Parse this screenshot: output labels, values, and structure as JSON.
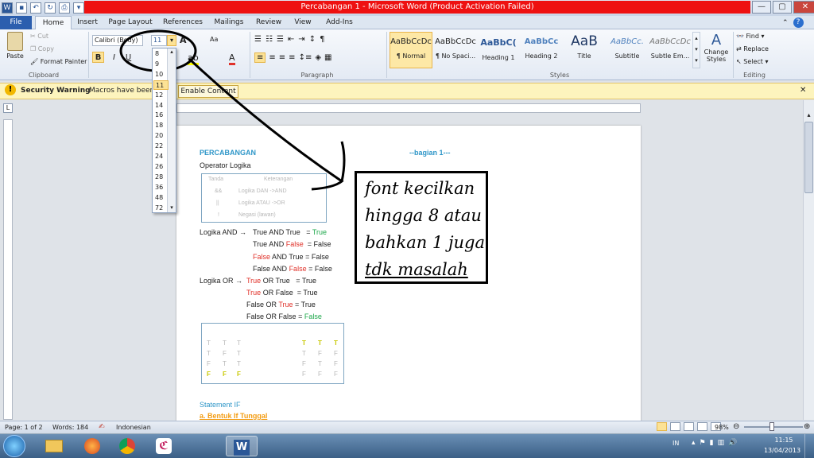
{
  "app": {
    "title": "Percabangan 1  -  Microsoft Word (Product Activation Failed)"
  },
  "window_controls": {
    "minimize": "—",
    "maximize": "▢",
    "close": "✕"
  },
  "tabs": [
    "File",
    "Home",
    "Insert",
    "Page Layout",
    "References",
    "Mailings",
    "Review",
    "View",
    "Add-Ins"
  ],
  "ribbon": {
    "clipboard": {
      "paste": "Paste",
      "cut": "Cut",
      "copy": "Copy",
      "format_painter": "Format Painter",
      "label": "Clipboard"
    },
    "font": {
      "name": "Calibri (Body)",
      "size": "11",
      "grow": "A",
      "shrink": "A",
      "change_case": "Aa",
      "clear": "Aa",
      "bold": "B",
      "italic": "I",
      "underline": "U",
      "label": "Font"
    },
    "paragraph": {
      "label": "Paragraph",
      "pilcrow": "¶"
    },
    "styles": {
      "label": "Styles",
      "items": [
        {
          "preview": "AaBbCcDc",
          "label": "¶ Normal"
        },
        {
          "preview": "AaBbCcDc",
          "label": "¶ No Spaci..."
        },
        {
          "preview": "AaBbC(",
          "label": "Heading 1"
        },
        {
          "preview": "AaBbCc",
          "label": "Heading 2"
        },
        {
          "preview": "AaB",
          "label": "Title"
        },
        {
          "preview": "AaBbCc.",
          "label": "Subtitle"
        },
        {
          "preview": "AaBbCcDc",
          "label": "Subtle Em..."
        }
      ],
      "change_styles": "Change Styles"
    },
    "editing": {
      "find": "Find",
      "replace": "Replace",
      "select": "Select",
      "label": "Editing"
    }
  },
  "security": {
    "title": "Security Warning",
    "message": "Macros have been disabled.",
    "button": "Enable Content",
    "close": "✕"
  },
  "font_sizes": [
    "8",
    "9",
    "10",
    "11",
    "12",
    "14",
    "16",
    "18",
    "20",
    "22",
    "24",
    "26",
    "28",
    "36",
    "48",
    "72"
  ],
  "document": {
    "heading": "PERCABANGAN",
    "part": "--bagian 1---",
    "operator_title": "Operator Logika",
    "op_table": {
      "headers": [
        "Tanda",
        "Keterangan"
      ],
      "rows": [
        [
          "&&",
          "Logika DAN ->AND"
        ],
        [
          "||",
          "Logika ATAU ->OR"
        ],
        [
          "!",
          "Negasi (lawan)"
        ]
      ]
    },
    "and_label": "Logika AND",
    "and_rows": [
      {
        "a": "True",
        "op": "AND",
        "b": "True",
        "res": "True"
      },
      {
        "a": "True",
        "op": "AND",
        "b": "False",
        "res": "False"
      },
      {
        "a": "False",
        "op": "AND",
        "b": "True",
        "res": "False"
      },
      {
        "a": "False",
        "op": "AND",
        "b": "False",
        "res": "False"
      }
    ],
    "or_label": "Logika OR",
    "or_rows": [
      {
        "a": "True",
        "op": "OR",
        "b": "True",
        "res": "True"
      },
      {
        "a": "True",
        "op": "OR",
        "b": "False",
        "res": "True"
      },
      {
        "a": "False",
        "op": "OR",
        "b": "True",
        "res": "True"
      },
      {
        "a": "False",
        "op": "OR",
        "b": "False",
        "res": "False"
      }
    ],
    "tf_left": [
      [
        "T",
        "T",
        "T"
      ],
      [
        "T",
        "F",
        "T"
      ],
      [
        "F",
        "T",
        "T"
      ],
      [
        "F",
        "F",
        "F"
      ]
    ],
    "tf_right": [
      [
        "T",
        "T",
        "T"
      ],
      [
        "T",
        "F",
        "F"
      ],
      [
        "F",
        "T",
        "F"
      ],
      [
        "F",
        "F",
        "F"
      ]
    ],
    "statement": "Statement IF",
    "bentuk": "a. Bentuk If Tunggal"
  },
  "annotation": {
    "lines": [
      "font kecilkan",
      "hingga 8 atau",
      "bahkan 1 juga",
      "tdk masalah"
    ]
  },
  "status": {
    "page": "Page: 1 of 2",
    "words": "Words: 184",
    "language": "Indonesian",
    "zoom": "98%"
  },
  "taskbar": {
    "lang": "IN",
    "time": "11:15",
    "date": "13/04/2013"
  },
  "colors": {
    "accent_red": "#ee1111",
    "file_tab": "#2b5eae",
    "true_green": "#1ea84b",
    "false_red": "#e0322a"
  }
}
